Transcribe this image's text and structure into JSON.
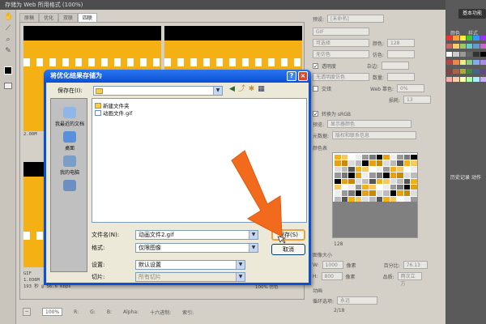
{
  "window": {
    "title": "存储为 Web 所用格式 (100%)"
  },
  "workspace_button": "基本功能",
  "tabs": [
    "原稿",
    "优化",
    "双联",
    "四联"
  ],
  "preview_info": {
    "original_size": "2.00M",
    "optimized_format": "GIF",
    "optimized_size": "1.036M",
    "optimized_time": "193 秒 @ 56.6 Kbps",
    "percent": "100% 仿色"
  },
  "status_bar": {
    "zoom": "100%",
    "r": "R:",
    "g": "G:",
    "b": "B:",
    "alpha": "Alpha:",
    "hex": "十六进制:",
    "index": "索引:"
  },
  "settings": {
    "preset_label": "预设:",
    "preset_value": "[未命名]",
    "format": "GIF",
    "reduction": "可选择",
    "colors_label": "颜色:",
    "colors_value": "128",
    "dither": "无仿色",
    "dither_label": "仿色:",
    "transparency_label": "透明度",
    "matte_label": "杂边:",
    "no_transparency_dither": "无透明度仿色",
    "amount_label": "数量:",
    "interlaced_label": "交错",
    "web_snap_label": "Web 靠色:",
    "web_snap_value": "0%",
    "lossy_label": "损耗:",
    "lossy_value": "13",
    "srgb_label": "转换为 sRGB",
    "preview_label": "预览:",
    "preview_value": "显示器颜色",
    "metadata_label": "元数据:",
    "metadata_value": "版权和联系信息",
    "color_table_label": "颜色表",
    "color_count": "128",
    "image_size_label": "图像大小",
    "w_label": "W:",
    "w_value": "1000",
    "h_label": "H:",
    "h_value": "800",
    "px": "像素",
    "percent_label": "百分比:",
    "percent_value": "76.13",
    "quality_label": "品质:",
    "quality_value": "两次立方",
    "animation_label": "动画",
    "loop_label": "循环选项:",
    "loop_value": "永远",
    "frame_counter": "2/18"
  },
  "ps_panel": {
    "tab_color": "颜色",
    "tab_swatches": "样式",
    "history": "历史记录",
    "actions": "动作"
  },
  "dialog": {
    "title": "将优化结果存储为",
    "save_in_label": "保存在(I):",
    "save_in_value": "",
    "places": [
      "我最近的文档",
      "桌面",
      "我的电脑"
    ],
    "files": [
      "新建文件夹",
      "动画文件.gif"
    ],
    "filename_label": "文件名(N):",
    "filename_value": "动画文件2.gif",
    "format_label": "格式:",
    "format_value": "仅限图像",
    "settings_label": "设置:",
    "settings_value": "默认设置",
    "slices_label": "切片:",
    "slices_value": "所有切片",
    "save_button": "保存(S)",
    "cancel_button": "取消"
  },
  "colors": {
    "titlebar_blue": "#0a4fd8",
    "accent_orange": "#f26a1b",
    "image_yellow": "#f5b014"
  }
}
